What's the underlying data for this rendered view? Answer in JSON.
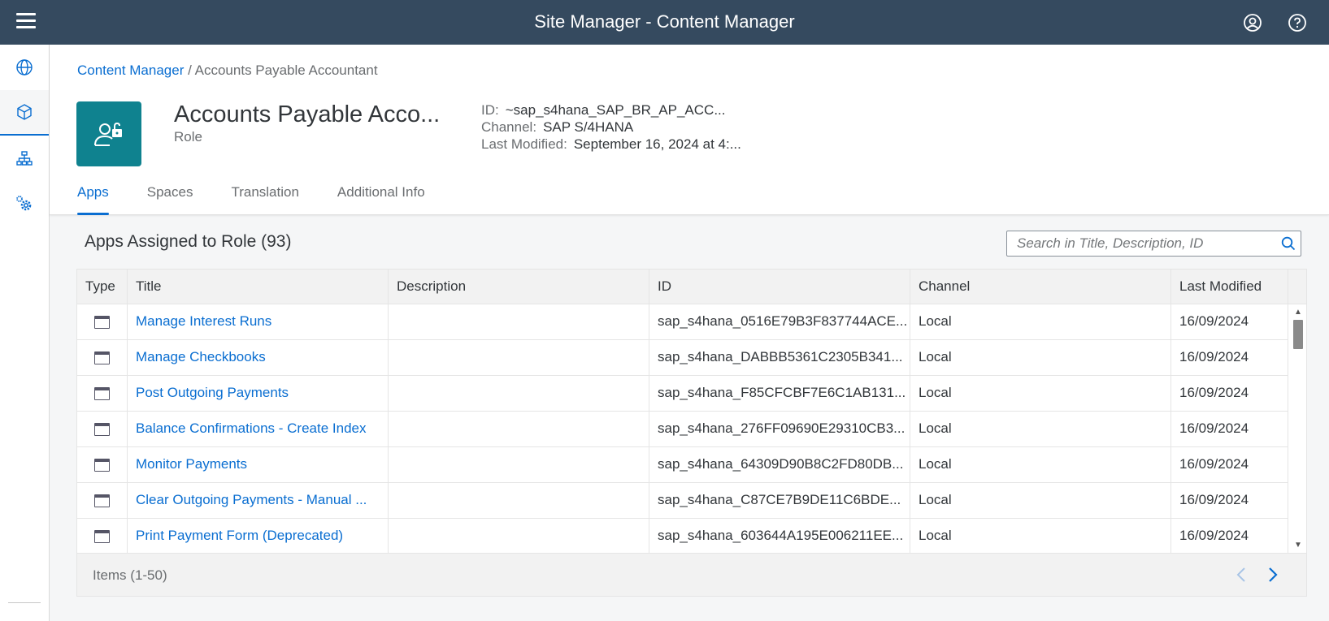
{
  "shell": {
    "title": "Site Manager - Content Manager",
    "menu_icon": "hamburger-icon",
    "user_icon": "user-circle-icon",
    "help_icon": "help-icon"
  },
  "sidenav": {
    "items": [
      {
        "name": "sites",
        "icon": "globe-icon"
      },
      {
        "name": "content",
        "icon": "cube-icon",
        "selected": true
      },
      {
        "name": "hierarchy",
        "icon": "org-chart-icon"
      },
      {
        "name": "settings",
        "icon": "gears-icon"
      }
    ]
  },
  "breadcrumb": {
    "link": "Content Manager",
    "separator": "/",
    "current": "Accounts Payable Accountant"
  },
  "object": {
    "title": "Accounts Payable Acco...",
    "subtitle": "Role",
    "id_label": "ID:",
    "id_value": "~sap_s4hana_SAP_BR_AP_ACC...",
    "channel_label": "Channel:",
    "channel_value": "SAP S/4HANA",
    "modified_label": "Last Modified:",
    "modified_value": "September 16, 2024 at 4:..."
  },
  "tabs": [
    {
      "label": "Apps",
      "active": true
    },
    {
      "label": "Spaces"
    },
    {
      "label": "Translation"
    },
    {
      "label": "Additional Info"
    }
  ],
  "panel": {
    "title": "Apps Assigned to Role (93)",
    "search_placeholder": "Search in Title, Description, ID"
  },
  "table": {
    "columns": [
      "Type",
      "Title",
      "Description",
      "ID",
      "Channel",
      "Last Modified"
    ],
    "rows": [
      {
        "title": "Manage Interest Runs",
        "description": "",
        "id": "sap_s4hana_0516E79B3F837744ACE...",
        "channel": "Local",
        "modified": "16/09/2024"
      },
      {
        "title": "Manage Checkbooks",
        "description": "",
        "id": "sap_s4hana_DABBB5361C2305B341...",
        "channel": "Local",
        "modified": "16/09/2024"
      },
      {
        "title": "Post Outgoing Payments",
        "description": "",
        "id": "sap_s4hana_F85CFCBF7E6C1AB131...",
        "channel": "Local",
        "modified": "16/09/2024"
      },
      {
        "title": "Balance Confirmations - Create Index",
        "description": "",
        "id": "sap_s4hana_276FF09690E29310CB3...",
        "channel": "Local",
        "modified": "16/09/2024"
      },
      {
        "title": "Monitor Payments",
        "description": "",
        "id": "sap_s4hana_64309D90B8C2FD80DB...",
        "channel": "Local",
        "modified": "16/09/2024"
      },
      {
        "title": "Clear Outgoing Payments - Manual ...",
        "description": "",
        "id": "sap_s4hana_C87CE7B9DE11C6BDE...",
        "channel": "Local",
        "modified": "16/09/2024"
      },
      {
        "title": "Print Payment Form (Deprecated)",
        "description": "",
        "id": "sap_s4hana_603644A195E006211EE...",
        "channel": "Local",
        "modified": "16/09/2024"
      }
    ],
    "footer_count": "Items (1-50)"
  },
  "colors": {
    "shell_bg": "#354a5f",
    "accent": "#0a6ed1",
    "avatar_bg": "#0f828f"
  }
}
